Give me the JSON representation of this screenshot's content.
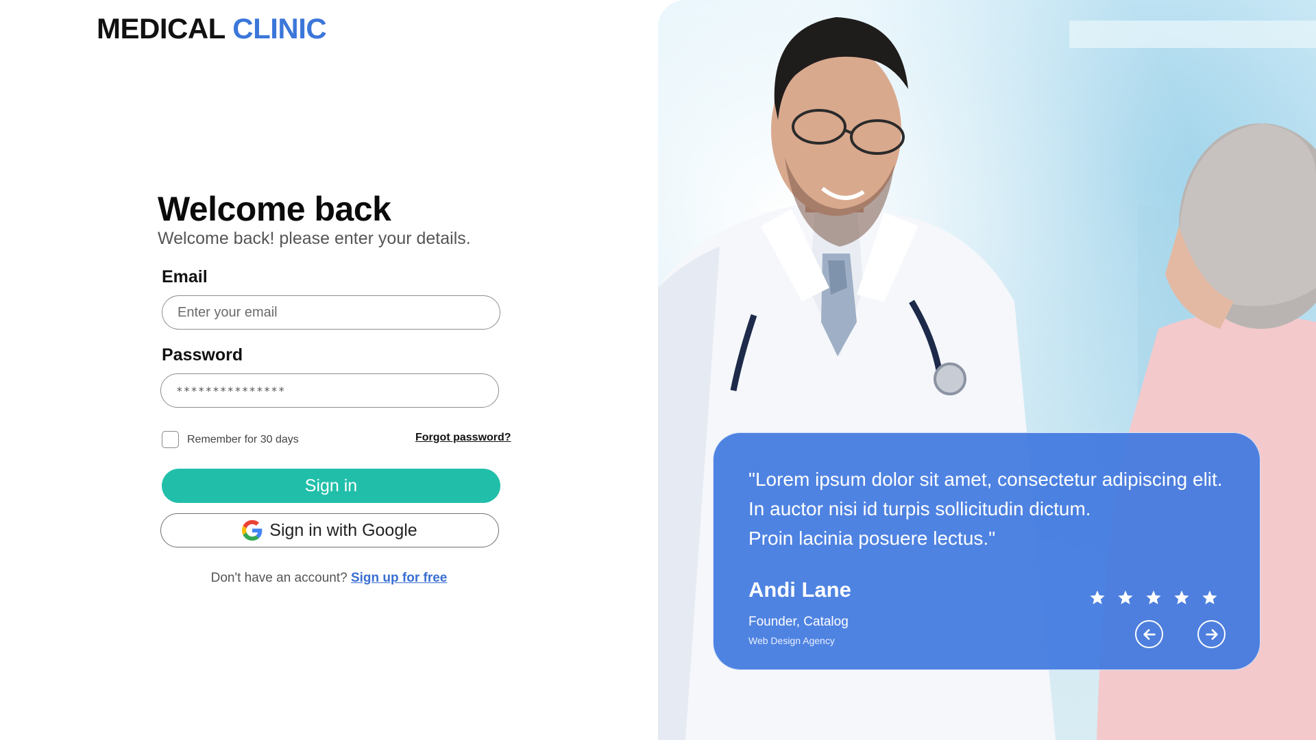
{
  "brand": {
    "part1": "MEDICAL",
    "part2": "CLINIC"
  },
  "login": {
    "title": "Welcome back",
    "subtitle": "Welcome back! please enter your details.",
    "email_label": "Email",
    "email_placeholder": "Enter your email",
    "password_label": "Password",
    "password_value": "***************",
    "remember_label": "Remember for 30 days",
    "remember_checked": false,
    "forgot_label": "Forgot password?",
    "signin_label": "Sign in",
    "google_label": "Sign in with Google",
    "signup_prompt": "Don't have an account?",
    "signup_link": "Sign up for free"
  },
  "testimonial": {
    "quote_lines": [
      "\"Lorem ipsum dolor sit amet, consectetur  adipiscing elit.",
      "In auctor nisi id turpis sollicitudin dictum.",
      "Proin lacinia posuere lectus.\""
    ],
    "author": "Andi Lane",
    "role": "Founder, Catalog",
    "company": "Web Design Agency",
    "rating": 5,
    "icons": {
      "prev": "arrow-left-icon",
      "next": "arrow-right-icon",
      "star": "star-icon"
    }
  },
  "colors": {
    "brand_blue": "#3b77d9",
    "signin_green": "#21bfaa",
    "card_blue": "#4078e0",
    "link_blue": "#3a6fd1"
  }
}
